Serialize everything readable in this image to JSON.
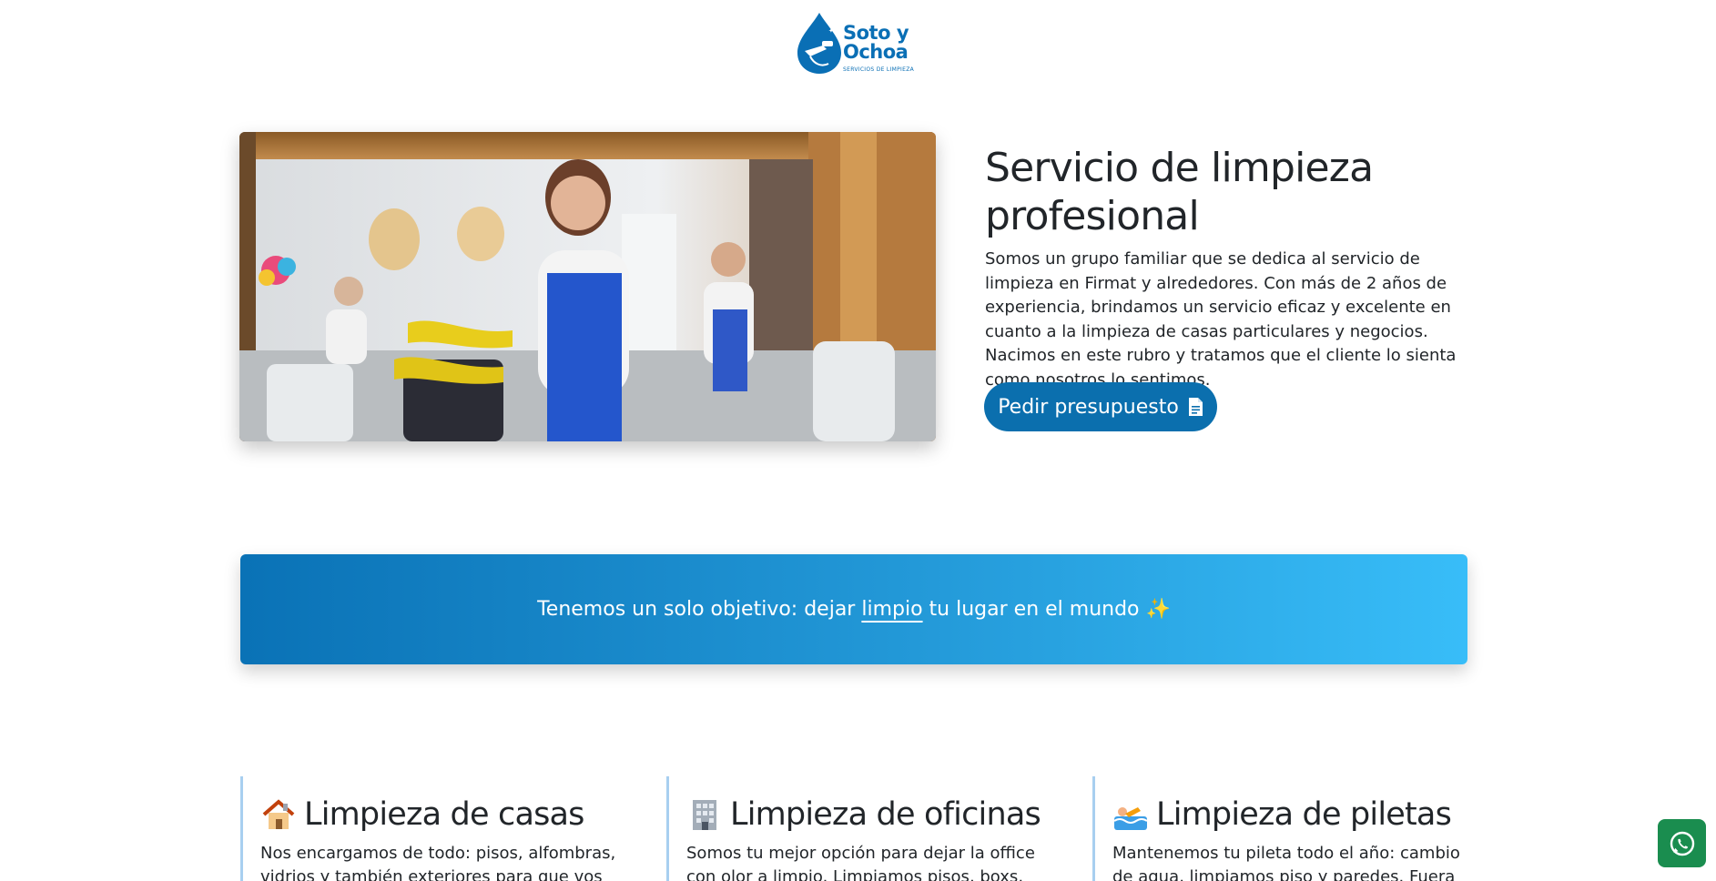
{
  "brand": {
    "name_line1": "Soto y",
    "name_line2": "Ochoa",
    "tagline": "SERVICIOS DE LIMPIEZA",
    "color": "#0a6fb5"
  },
  "hero": {
    "title": "Servicio de limpieza profesional",
    "description": "Somos un grupo familiar que se dedica al servicio de limpieza en Firmat y alrededores. Con más de 2 años de experiencia, brindamos un servicio eficaz y excelente en cuanto a la limpieza de casas particulares y negocios. Nacimos en este rubro y tratamos que el cliente lo sienta como nosotros lo sentimos.",
    "cta_label": "Pedir presupuesto",
    "cta_icon": "document-icon",
    "cta_color": "#0b6fae"
  },
  "banner": {
    "text_before": "Tenemos un solo objetivo: dejar ",
    "text_underlined": "limpio",
    "text_after": " tu lugar en el mundo ✨"
  },
  "services": [
    {
      "icon": "house-icon",
      "title": "Limpieza de casas",
      "description": "Nos encargamos de todo: pisos, alfombras, vidrios y también exteriores para que vos no"
    },
    {
      "icon": "office-building-icon",
      "title": "Limpieza de oficinas",
      "description": "Somos tu mejor opción para dejar la office con olor a limpio. Limpiamos pisos, boxs,"
    },
    {
      "icon": "swimmer-icon",
      "title": "Limpieza de piletas",
      "description": "Mantenemos tu pileta todo el año: cambio de agua, limpiamos piso y paredes. Fuera"
    }
  ],
  "whatsapp": {
    "icon": "whatsapp-icon",
    "color": "#1a8d4f"
  }
}
